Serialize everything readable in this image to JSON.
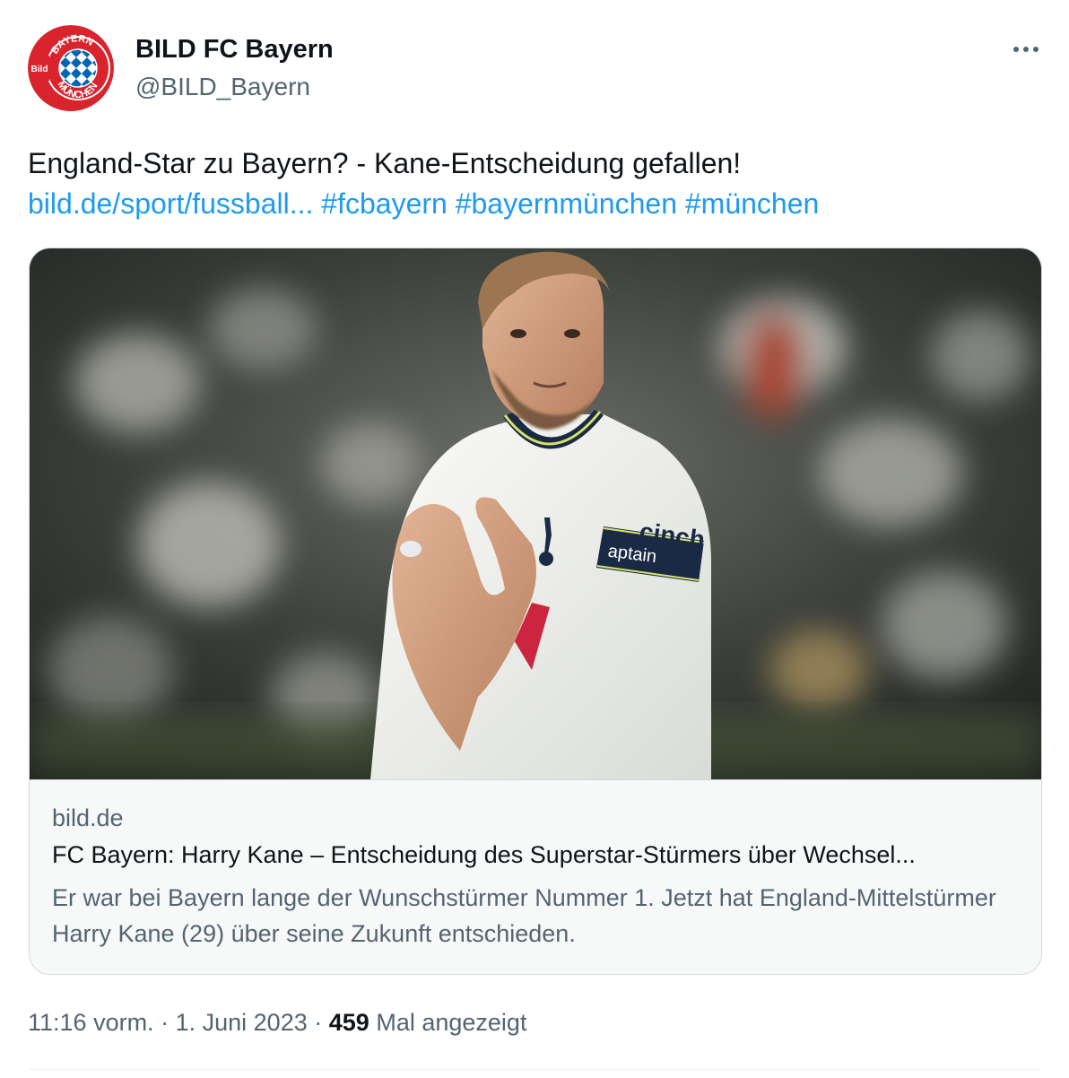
{
  "author": {
    "display_name": "BILD FC Bayern",
    "handle": "@BILD_Bayern",
    "avatar": {
      "icon": "bild-fc-bayern-logo",
      "text_top": "BAYERN",
      "text_bottom": "MÜNCHEN",
      "text_badge": "Bild"
    }
  },
  "more_icon": "more-horizontal-icon",
  "tweet": {
    "text": "England-Star zu Bayern? - Kane-Entscheidung gefallen!",
    "link": "bild.de/sport/fussball...",
    "hashtags": [
      "#fcbayern",
      "#bayernmünchen",
      "#münchen"
    ]
  },
  "card": {
    "domain": "bild.de",
    "title": "FC Bayern: Harry Kane – Entscheidung des Superstar-Stürmers über Wechsel...",
    "description": "Er war bei Bayern lange der Wunschstürmer Nummer 1. Jetzt hat England-Mittelstürmer Harry Kane (29) über seine Zukunft entschieden.",
    "image_text": {
      "sponsor": "cinch",
      "armband": "aptain"
    }
  },
  "meta": {
    "time": "11:16 vorm.",
    "separator": "·",
    "date": "1. Juni 2023",
    "views_count": "459",
    "views_label": "Mal angezeigt"
  },
  "colors": {
    "link": "#1d9bf0",
    "text": "#0f1419",
    "secondary": "#536471",
    "border": "#cfd9de",
    "bild_red": "#d9232d",
    "bayern_blue": "#0066b2"
  }
}
